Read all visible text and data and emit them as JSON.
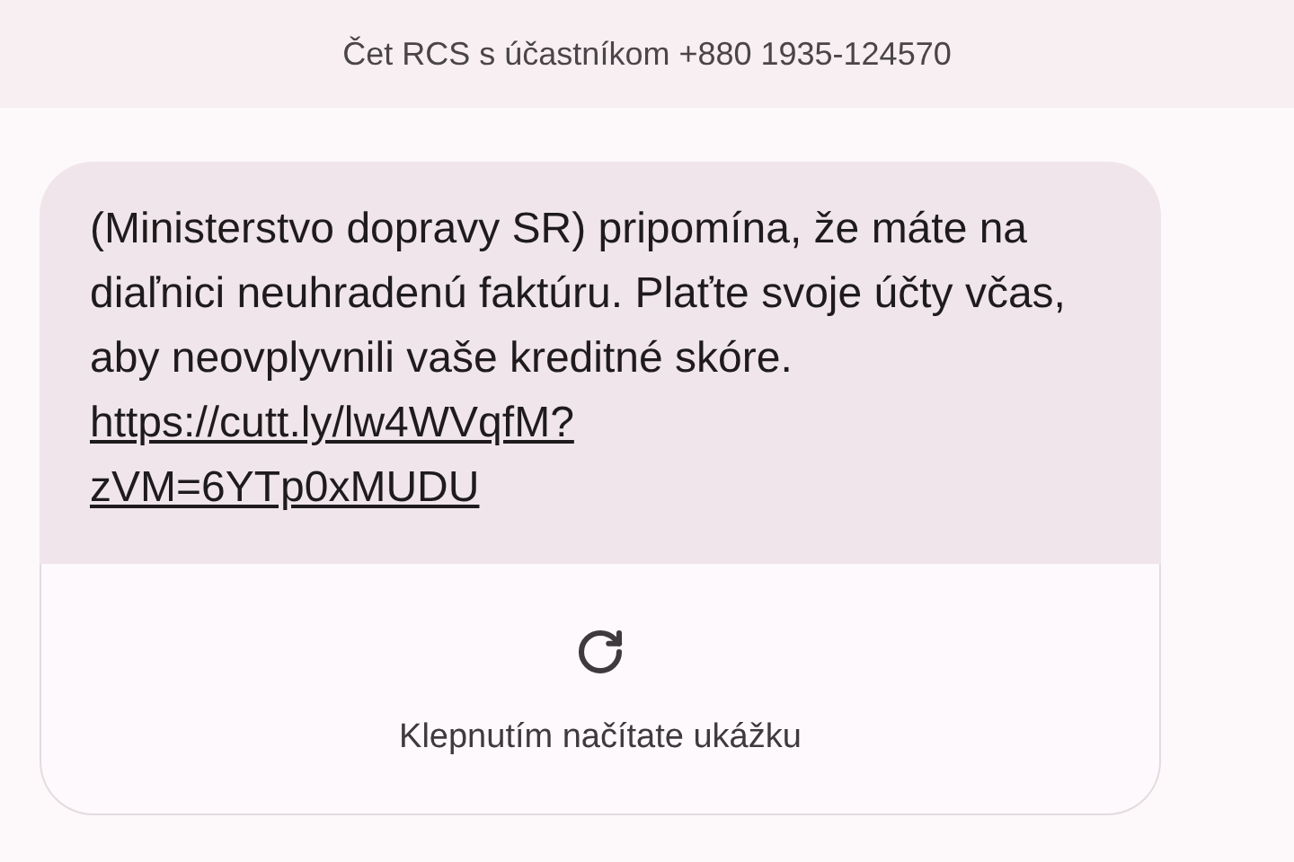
{
  "header": {
    "title": "Čet RCS s účastníkom +880 1935-124570"
  },
  "message": {
    "text": "(Ministerstvo dopravy SR) pripomína, že máte na diaľnici neuhradenú faktúru. Plaťte svoje účty včas, aby neovplyvnili vaše kreditné skóre.",
    "link": "https://cutt.ly/lw4WVqfM?zVM=6YTp0xMUDU"
  },
  "link_preview": {
    "label": "Klepnutím načítate ukážku"
  }
}
